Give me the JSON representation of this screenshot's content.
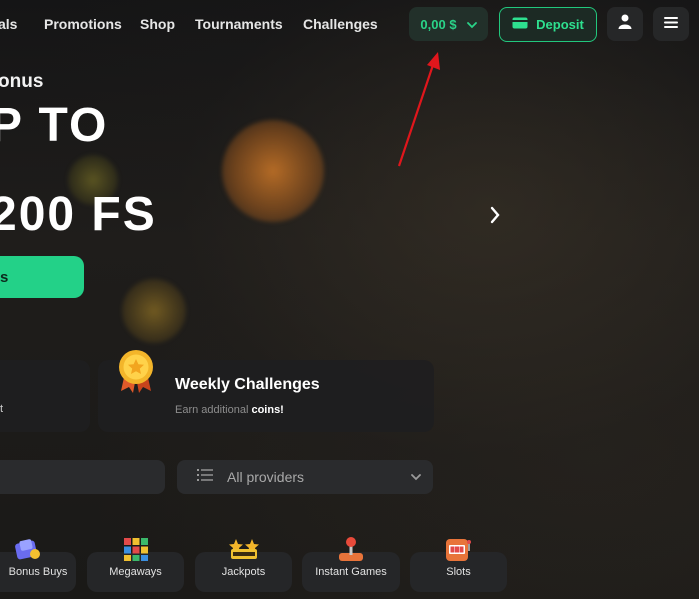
{
  "header": {
    "nav": [
      {
        "label": "als"
      },
      {
        "label": "Promotions"
      },
      {
        "label": "Shop"
      },
      {
        "label": "Tournaments"
      },
      {
        "label": "Challenges"
      }
    ],
    "balance": "0,00 $",
    "deposit_label": "Deposit"
  },
  "hero": {
    "subtitle": "onus",
    "line1": "P TO",
    "line2": "200 FS",
    "cta_label": "s"
  },
  "promo": {
    "left_card_text": "t",
    "right_card_title": "Weekly Challenges",
    "right_card_sub_prefix": "Earn additional ",
    "right_card_sub_highlight": "coins!"
  },
  "filters": {
    "providers_label": "All providers"
  },
  "categories": [
    {
      "label": "Bonus Buys",
      "icon": "bonus-buys-icon"
    },
    {
      "label": "Megaways",
      "icon": "megaways-icon"
    },
    {
      "label": "Jackpots",
      "icon": "jackpot-icon"
    },
    {
      "label": "Instant Games",
      "icon": "joystick-icon"
    },
    {
      "label": "Slots",
      "icon": "slot-machine-icon"
    }
  ],
  "colors": {
    "accent": "#23d188",
    "accent_text": "#2ad388",
    "background": "#1b1b1d",
    "panel": "#2a2b2d",
    "annotation_arrow": "#e0161c"
  }
}
